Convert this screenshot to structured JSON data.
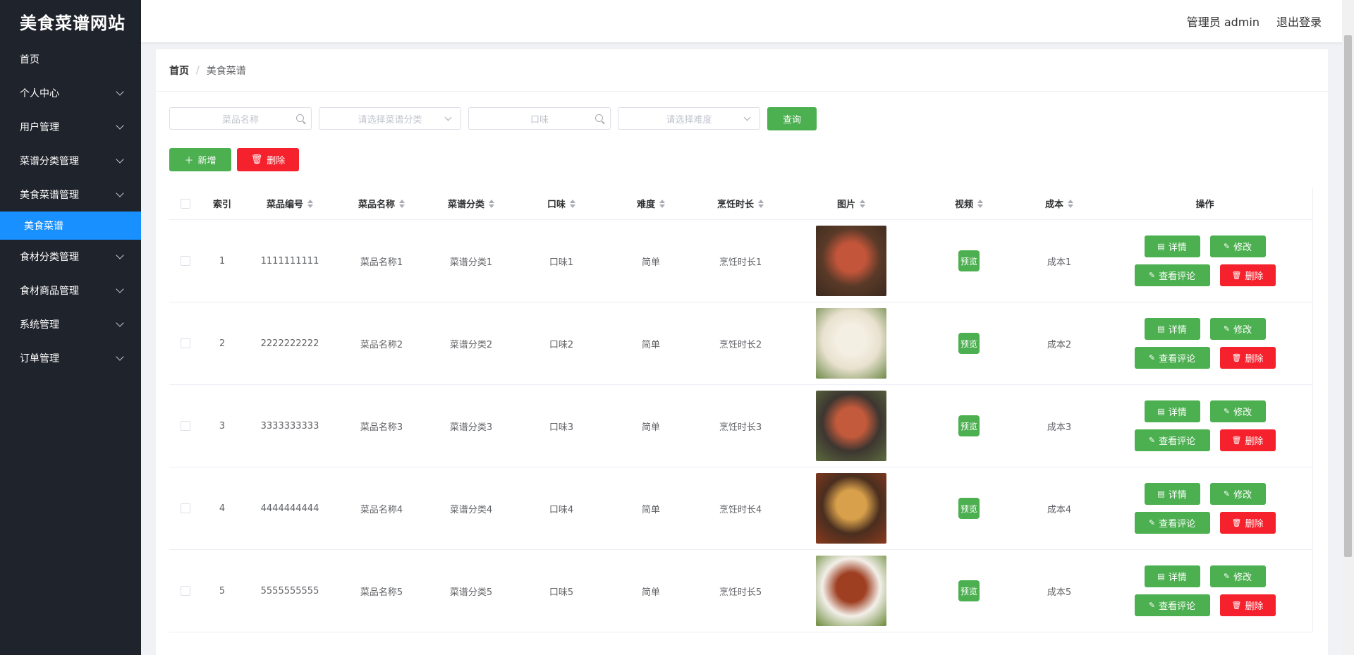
{
  "app": {
    "title": "美食菜谱网站"
  },
  "sidebar": {
    "items": [
      {
        "label": "首页",
        "has_children": false
      },
      {
        "label": "个人中心",
        "has_children": true
      },
      {
        "label": "用户管理",
        "has_children": true
      },
      {
        "label": "菜谱分类管理",
        "has_children": true
      },
      {
        "label": "美食菜谱管理",
        "has_children": true
      },
      {
        "label": "美食菜谱",
        "sub": true,
        "active": true
      },
      {
        "label": "食材分类管理",
        "has_children": true
      },
      {
        "label": "食材商品管理",
        "has_children": true
      },
      {
        "label": "系统管理",
        "has_children": true
      },
      {
        "label": "订单管理",
        "has_children": true
      }
    ]
  },
  "header": {
    "user": "管理员 admin",
    "logout": "退出登录"
  },
  "breadcrumb": {
    "home": "首页",
    "separator": "/",
    "current": "美食菜谱"
  },
  "filters": {
    "name_placeholder": "菜品名称",
    "category_placeholder": "请选择菜谱分类",
    "taste_placeholder": "口味",
    "difficulty_placeholder": "请选择难度",
    "query": "查询"
  },
  "actions": {
    "add": "新增",
    "delete": "删除"
  },
  "table": {
    "headers": [
      "索引",
      "菜品编号",
      "菜品名称",
      "菜谱分类",
      "口味",
      "难度",
      "烹饪时长",
      "图片",
      "视频",
      "成本",
      "操作"
    ],
    "rows": [
      {
        "index": "1",
        "no": "1111111111",
        "name": "菜品名称1",
        "category": "菜谱分类1",
        "taste": "口味1",
        "difficulty": "简单",
        "time": "烹饪时长1",
        "cost": "成本1",
        "img_colors": [
          "#5a3a28",
          "#c2553a",
          "#3b2a1e"
        ]
      },
      {
        "index": "2",
        "no": "2222222222",
        "name": "菜品名称2",
        "category": "菜谱分类2",
        "taste": "口味2",
        "difficulty": "简单",
        "time": "烹饪时长2",
        "cost": "成本2",
        "img_colors": [
          "#e8e1cf",
          "#f4efe3",
          "#6f8a4a"
        ]
      },
      {
        "index": "3",
        "no": "3333333333",
        "name": "菜品名称3",
        "category": "菜谱分类3",
        "taste": "口味3",
        "difficulty": "简单",
        "time": "烹饪时长3",
        "cost": "成本3",
        "img_colors": [
          "#3d3631",
          "#c35a3b",
          "#5c6b3e"
        ]
      },
      {
        "index": "4",
        "no": "4444444444",
        "name": "菜品名称4",
        "category": "菜谱分类4",
        "taste": "口味4",
        "difficulty": "简单",
        "time": "烹饪时长4",
        "cost": "成本4",
        "img_colors": [
          "#4a2e1f",
          "#d8a04a",
          "#8a3a1e"
        ]
      },
      {
        "index": "5",
        "no": "5555555555",
        "name": "菜品名称5",
        "category": "菜谱分类5",
        "taste": "口味5",
        "difficulty": "简单",
        "time": "烹饪时长5",
        "cost": "成本5",
        "img_colors": [
          "#f3efe9",
          "#9e3f22",
          "#6a8a3a"
        ]
      }
    ],
    "video_label": "预览",
    "ops": {
      "detail": "详情",
      "edit": "修改",
      "comment": "查看评论",
      "delete": "删除"
    }
  },
  "colors": {
    "sidebar": "#1f232b",
    "active": "#1890ff",
    "green": "#4caf50",
    "red": "#f5222d"
  }
}
